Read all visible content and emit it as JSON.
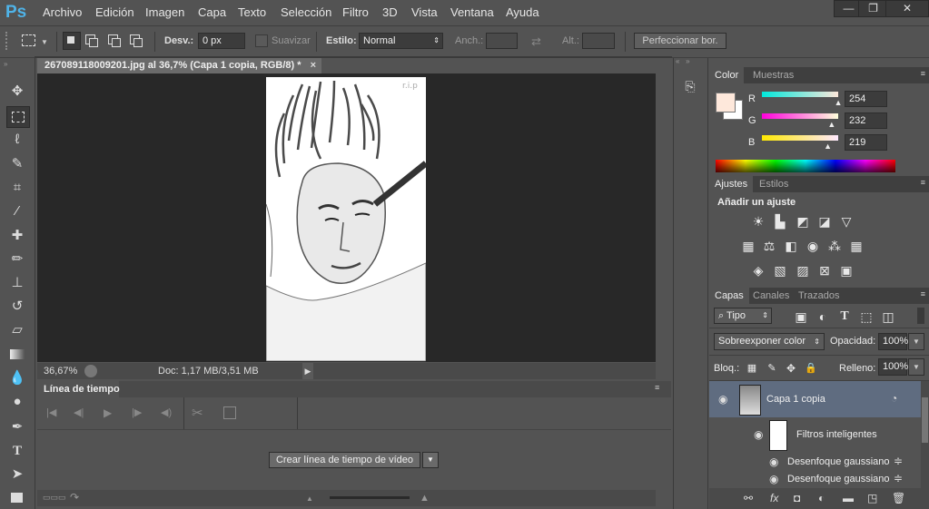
{
  "app": {
    "logo": "Ps"
  },
  "menu": {
    "items": [
      "Archivo",
      "Edición",
      "Imagen",
      "Capa",
      "Texto",
      "Selección",
      "Filtro",
      "3D",
      "Vista",
      "Ventana",
      "Ayuda"
    ]
  },
  "window_controls": {
    "minimize": "—",
    "restore": "❐",
    "close": "✕"
  },
  "options": {
    "desv_label": "Desv.:",
    "desv_value": "0 px",
    "suavizar_label": "Suavizar",
    "estilo_label": "Estilo:",
    "estilo_value": "Normal",
    "anch_label": "Anch.:",
    "alt_label": "Alt.:",
    "refine_button": "Perfeccionar bor."
  },
  "document": {
    "tab_title": "267089118009201.jpg al 36,7% (Capa 1 copia, RGB/8) *",
    "close": "×",
    "zoom": "36,67%",
    "doc_size": "Doc: 1,17 MB/3,51 MB",
    "watermark": "r.i.p"
  },
  "timeline": {
    "title": "Línea de tiempo",
    "create_button": "Crear línea de tiempo de vídeo"
  },
  "color_panel": {
    "tabs": [
      "Color",
      "Muestras"
    ],
    "r_label": "R",
    "g_label": "G",
    "b_label": "B",
    "r_value": "254",
    "g_value": "232",
    "b_value": "219",
    "r": 254,
    "g": 232,
    "b": 219,
    "foreground": "#fee8db",
    "background": "#ffffff"
  },
  "adjustments_panel": {
    "tabs": [
      "Ajustes",
      "Estilos"
    ],
    "heading": "Añadir un ajuste"
  },
  "layers_panel": {
    "tabs": [
      "Capas",
      "Canales",
      "Trazados"
    ],
    "filter_kind": "Tipo",
    "blend_mode": "Sobreexponer color",
    "opacity_label": "Opacidad:",
    "opacity_value": "100%",
    "lock_label": "Bloq.:",
    "fill_label": "Relleno:",
    "fill_value": "100%",
    "layers": [
      {
        "name": "Capa 1 copia"
      },
      {
        "name": "Filtros inteligentes"
      },
      {
        "name": "Desenfoque gaussiano"
      },
      {
        "name": "Desenfoque gaussiano"
      }
    ]
  }
}
